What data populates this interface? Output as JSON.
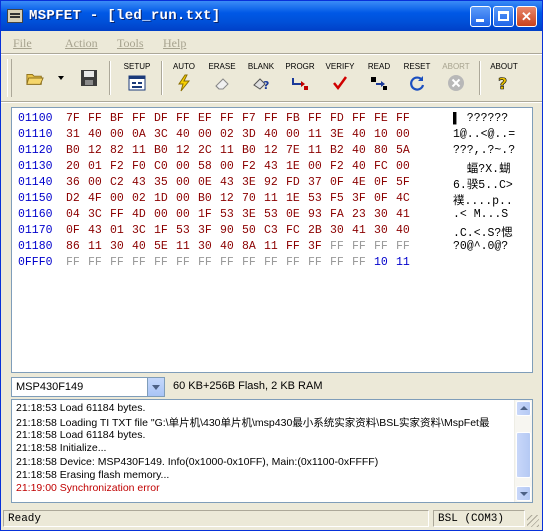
{
  "window": {
    "title": "MSPFET - [led_run.txt]"
  },
  "menu": [
    "File",
    "Action",
    "Tools",
    "Help"
  ],
  "toolbar": {
    "setup": "SETUP",
    "auto": "AUTO",
    "erase": "ERASE",
    "blank": "BLANK",
    "progr": "PROGR",
    "verify": "VERIFY",
    "read": "READ",
    "reset": "RESET",
    "abort": "ABORT",
    "about": "ABOUT"
  },
  "hex": {
    "rows": [
      {
        "addr": "01100",
        "bytes": [
          "7F",
          "FF",
          "BF",
          "FF",
          "DF",
          "FF",
          "EF",
          "FF",
          "F7",
          "FF",
          "FB",
          "FF",
          "FD",
          "FF",
          "FE",
          "FF"
        ],
        "ascii": "▌ ??????"
      },
      {
        "addr": "01110",
        "bytes": [
          "31",
          "40",
          "00",
          "0A",
          "3C",
          "40",
          "00",
          "02",
          "3D",
          "40",
          "00",
          "11",
          "3E",
          "40",
          "10",
          "00"
        ],
        "ascii": "1@..<@..="
      },
      {
        "addr": "01120",
        "bytes": [
          "B0",
          "12",
          "82",
          "11",
          "B0",
          "12",
          "2C",
          "11",
          "B0",
          "12",
          "7E",
          "11",
          "B2",
          "40",
          "80",
          "5A"
        ],
        "ascii": "???,.?~.?"
      },
      {
        "addr": "01130",
        "bytes": [
          "20",
          "01",
          "F2",
          "F0",
          "C0",
          "00",
          "58",
          "00",
          "F2",
          "43",
          "1E",
          "00",
          "F2",
          "40",
          "FC",
          "00"
        ],
        "ascii": "  蝠?X.蝴"
      },
      {
        "addr": "01140",
        "bytes": [
          "36",
          "00",
          "C2",
          "43",
          "35",
          "00",
          "0E",
          "43",
          "3E",
          "92",
          "FD",
          "37",
          "0F",
          "4E",
          "0F",
          "5F"
        ],
        "ascii": "6.骙5..C>"
      },
      {
        "addr": "01150",
        "bytes": [
          "D2",
          "4F",
          "00",
          "02",
          "1D",
          "00",
          "B0",
          "12",
          "70",
          "11",
          "1E",
          "53",
          "F5",
          "3F",
          "0F",
          "4C"
        ],
        "ascii": "襆....p.."
      },
      {
        "addr": "01160",
        "bytes": [
          "04",
          "3C",
          "FF",
          "4D",
          "00",
          "00",
          "1F",
          "53",
          "3E",
          "53",
          "0E",
          "93",
          "FA",
          "23",
          "30",
          "41"
        ],
        "ascii": ".< M...S"
      },
      {
        "addr": "01170",
        "bytes": [
          "0F",
          "43",
          "01",
          "3C",
          "1F",
          "53",
          "3F",
          "90",
          "50",
          "C3",
          "FC",
          "2B",
          "30",
          "41",
          "30",
          "40"
        ],
        "ascii": ".C.<.S?愢"
      },
      {
        "addr": "01180",
        "bytes": [
          "86",
          "11",
          "30",
          "40",
          "5E",
          "11",
          "30",
          "40",
          "8A",
          "11",
          "FF",
          "3F",
          "FF",
          "FF",
          "FF",
          "FF"
        ],
        "ascii": "?0@^.0@?"
      },
      {
        "addr": "0FFF0",
        "bytes": [
          "FF",
          "FF",
          "FF",
          "FF",
          "FF",
          "FF",
          "FF",
          "FF",
          "FF",
          "FF",
          "FF",
          "FF",
          "FF",
          "FF",
          "10",
          "11"
        ],
        "ascii": ""
      }
    ]
  },
  "device": {
    "selected": "MSP430F149",
    "info": "60 KB+256B Flash, 2 KB RAM"
  },
  "log": [
    {
      "text": "21:18:53  Load 61184 bytes.",
      "error": false
    },
    {
      "text": "21:18:58  Loading TI TXT file \"G:\\单片机\\430单片机\\msp430最小系统实家资料\\BSL实家资料\\MspFet最",
      "error": false
    },
    {
      "text": "21:18:58  Load 61184 bytes.",
      "error": false
    },
    {
      "text": "21:18:58  Initialize...",
      "error": false
    },
    {
      "text": "21:18:58  Device: MSP430F149. Info(0x1000-0x10FF), Main:(0x1100-0xFFFF)",
      "error": false
    },
    {
      "text": "21:18:58  Erasing flash memory...",
      "error": false
    },
    {
      "text": "21:19:00  Synchronization error",
      "error": true
    }
  ],
  "status": {
    "text": "Ready",
    "port": "BSL (COM3)"
  },
  "colors": {
    "title_bar": "#0054e3",
    "address": "#0000cc",
    "error": "#c00000"
  }
}
